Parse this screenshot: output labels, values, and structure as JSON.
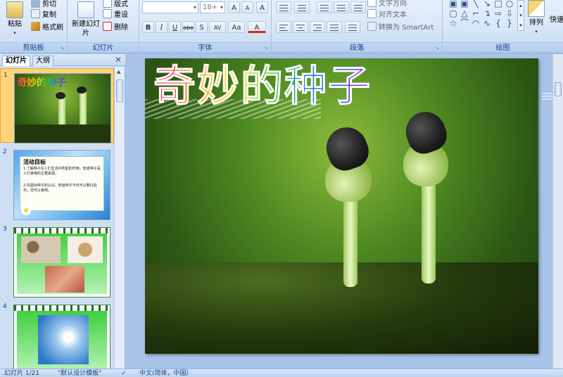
{
  "ribbon": {
    "clipboard": {
      "label": "剪贴板",
      "paste": "粘贴",
      "cut": "剪切",
      "copy": "复制",
      "format_painter": "格式刷"
    },
    "slides": {
      "label": "幻灯片",
      "new_slide": "新建幻灯片",
      "layout": "版式",
      "reset": "重设",
      "delete": "删除"
    },
    "font": {
      "label": "字体",
      "font_name": "",
      "font_size": "18+",
      "grow": "A",
      "shrink": "A",
      "clear": "A",
      "bold": "B",
      "italic": "I",
      "underline": "U",
      "strike": "abe",
      "shadow": "S",
      "spacing": "AV",
      "case": "Aa",
      "color": "A"
    },
    "paragraph": {
      "label": "段落",
      "text_direction": "文字方向",
      "align_text": "对齐文本",
      "smartart": "转换为 SmartArt"
    },
    "drawing": {
      "label": "绘图",
      "arrange": "排列",
      "quick_styles": "快速"
    }
  },
  "left_pane": {
    "tab_slides": "幻灯片",
    "tab_outline": "大纲",
    "close": "✕",
    "slides": [
      {
        "num": "1",
        "title": "奇妙的种子"
      },
      {
        "num": "2",
        "heading": "活动目标",
        "line1": "1.了解种子在人们生活中所起的作用。知道种子是人们食物的主要来源。",
        "line2": "2.巩固对种子的认识，知道种子不仅可以繁衍后代，还可以食用。"
      },
      {
        "num": "3"
      },
      {
        "num": "4"
      }
    ]
  },
  "main_slide": {
    "title": "奇妙的种子"
  },
  "status": {
    "slide": "幻灯片 1/21",
    "theme": "\"默认设计模板\"",
    "check": "✓",
    "language": "中文(简体，中国)"
  }
}
